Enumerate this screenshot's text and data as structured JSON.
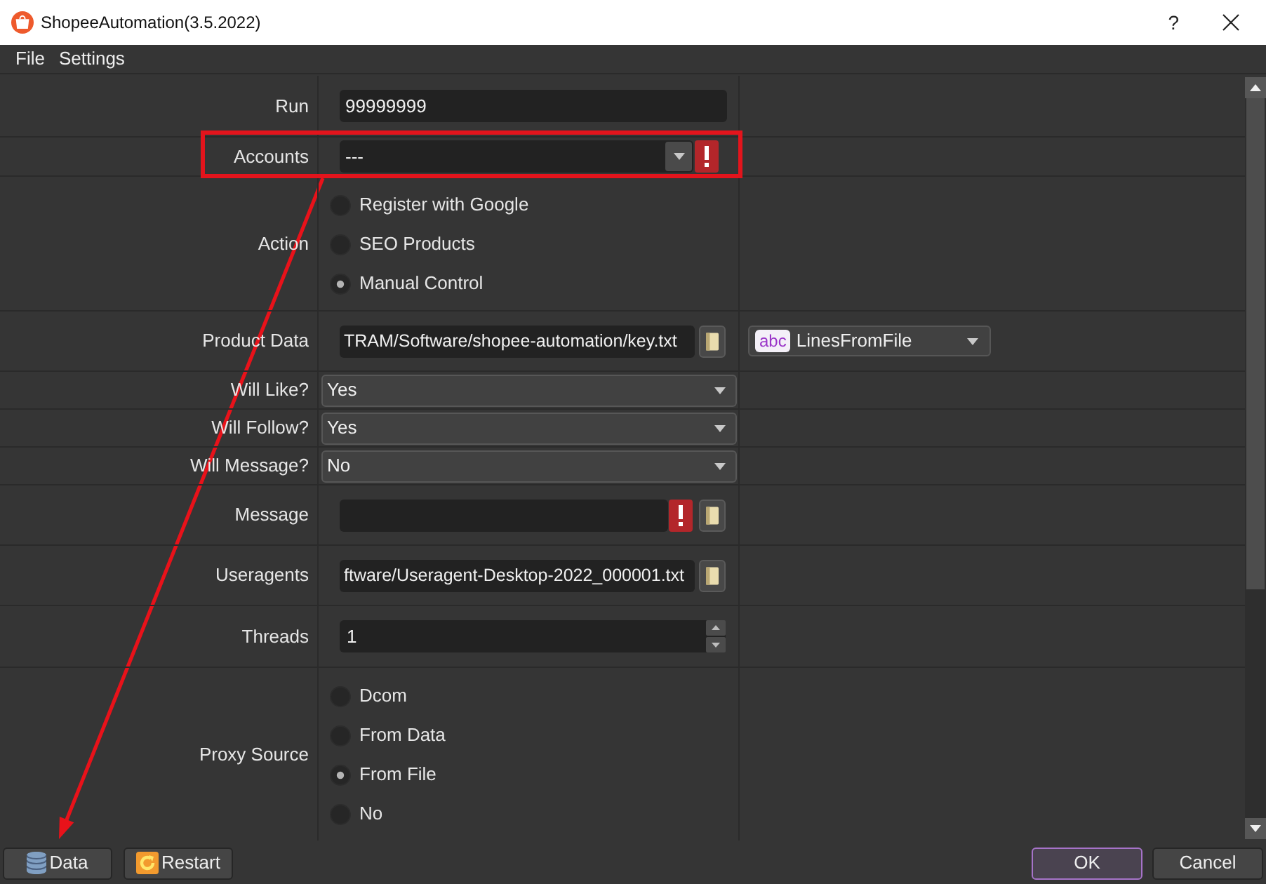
{
  "window": {
    "title": "ShopeeAutomation(3.5.2022)",
    "help": "?"
  },
  "menu": [
    {
      "label": "File"
    },
    {
      "label": "Settings"
    }
  ],
  "form": {
    "rows": [
      {
        "kind": "text",
        "label": "Run",
        "value": "99999999",
        "highlighted": false
      },
      {
        "kind": "combo",
        "label": "Accounts",
        "value": "---",
        "error": true,
        "highlighted": true
      },
      {
        "kind": "radio",
        "label": "Action",
        "highlighted": false,
        "options": [
          {
            "label": "Register with Google",
            "selected": false
          },
          {
            "label": "SEO Products",
            "selected": false
          },
          {
            "label": "Manual Control",
            "selected": true
          }
        ]
      },
      {
        "kind": "file",
        "label": "Product Data",
        "value": "TRAM/Software/shopee-automation/key.txt",
        "error": false,
        "highlighted": false,
        "source": {
          "badge": "abc",
          "value": "LinesFromFile"
        }
      },
      {
        "kind": "select",
        "label": "Will Like?",
        "value": "Yes",
        "highlighted": false
      },
      {
        "kind": "select",
        "label": "Will Follow?",
        "value": "Yes",
        "highlighted": false
      },
      {
        "kind": "select",
        "label": "Will Message?",
        "value": "No",
        "highlighted": false
      },
      {
        "kind": "file",
        "label": "Message",
        "error": true,
        "highlighted": false
      },
      {
        "kind": "file",
        "label": "Useragents",
        "value": "ftware/Useragent-Desktop-2022_000001.txt",
        "error": false,
        "highlighted": false
      },
      {
        "kind": "spin",
        "label": "Threads",
        "value": "1",
        "highlighted": false
      },
      {
        "kind": "radio",
        "label": "Proxy Source",
        "highlighted": false,
        "options": [
          {
            "label": "Dcom",
            "selected": false
          },
          {
            "label": "From Data",
            "selected": false
          },
          {
            "label": "From File",
            "selected": true
          },
          {
            "label": "No",
            "selected": false
          }
        ]
      }
    ]
  },
  "footer": {
    "left": [
      {
        "kind": "data",
        "label": "Data"
      },
      {
        "kind": "restart",
        "label": "Restart"
      }
    ],
    "right": [
      {
        "label": "OK",
        "default": true
      },
      {
        "label": "Cancel",
        "default": false
      }
    ]
  }
}
